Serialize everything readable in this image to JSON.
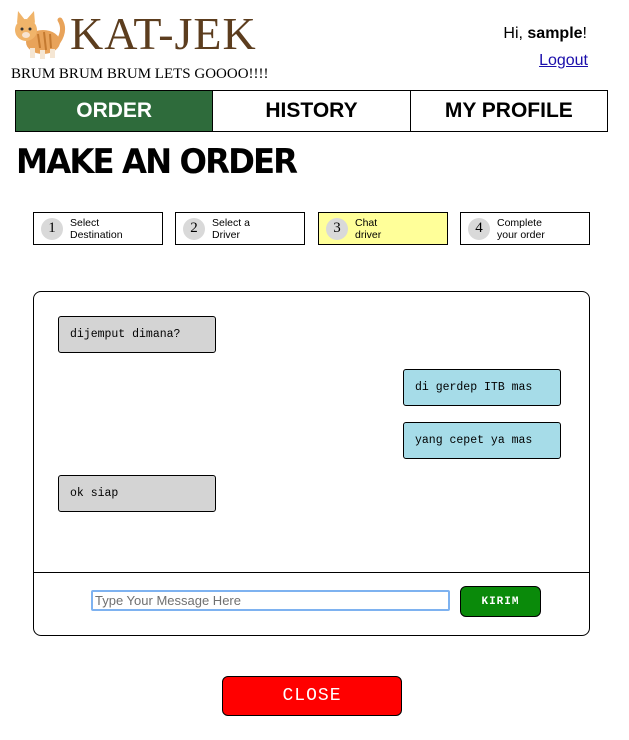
{
  "header": {
    "app_name": "KAT-JEK",
    "logo_icon": "cat-icon",
    "tagline": "BRUM BRUM BRUM LETS GOOOO!!!!",
    "greeting_prefix": "Hi, ",
    "username": "sample",
    "greeting_suffix": "!",
    "logout_label": "Logout"
  },
  "nav": {
    "tabs": [
      {
        "label": "ORDER",
        "active": true
      },
      {
        "label": "HISTORY",
        "active": false
      },
      {
        "label": "MY PROFILE",
        "active": false
      }
    ],
    "active_color": "#2e6b3b"
  },
  "page_title": "MAKE AN ORDER",
  "steps": [
    {
      "num": "1",
      "line1": "Select",
      "line2": "Destination",
      "active": false
    },
    {
      "num": "2",
      "line1": "Select a",
      "line2": "Driver",
      "active": false
    },
    {
      "num": "3",
      "line1": "Chat",
      "line2": "driver",
      "active": true
    },
    {
      "num": "4",
      "line1": "Complete",
      "line2": "your order",
      "active": false
    }
  ],
  "chat": {
    "messages": [
      {
        "text": "dijemput dimana?",
        "side": "left"
      },
      {
        "text": "di gerdep ITB mas",
        "side": "right"
      },
      {
        "text": "yang cepet ya mas",
        "side": "right"
      },
      {
        "text": "ok siap",
        "side": "left"
      }
    ],
    "input_placeholder": "Type Your Message Here",
    "input_value": "",
    "send_label": "KIRIM"
  },
  "close_label": "CLOSE",
  "colors": {
    "step_active": "#ffff99",
    "bubble_left": "#d4d4d4",
    "bubble_right": "#a6dce8",
    "send_button": "#0a8a0a",
    "close_button": "#ff0000"
  }
}
